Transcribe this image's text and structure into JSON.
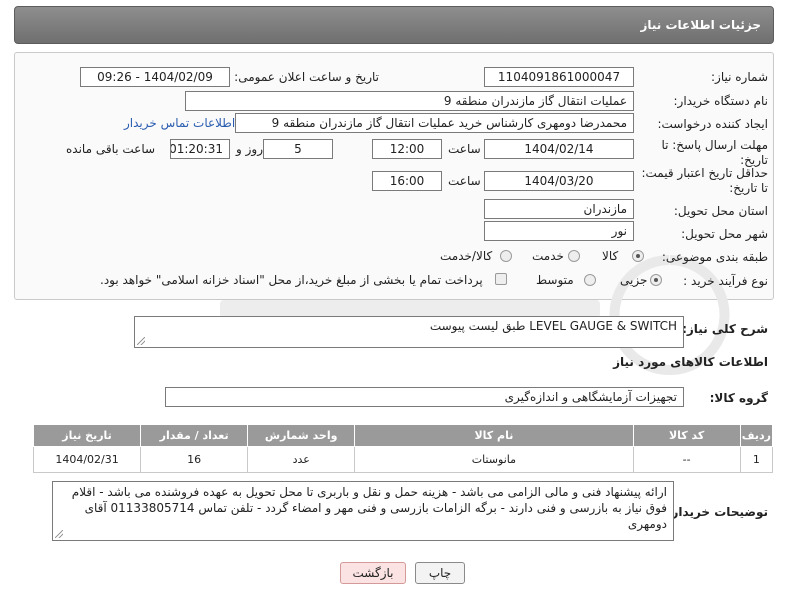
{
  "header": {
    "title": "جزئیات اطلاعات نیاز"
  },
  "form": {
    "need_number_label": "شماره نیاز:",
    "need_number": "1104091861000047",
    "announce_label": "تاریخ و ساعت اعلان عمومی:",
    "announce_value": "1404/02/09 - 09:26",
    "buyer_org_label": "نام دستگاه خریدار:",
    "buyer_org": "عملیات انتقال گاز مازندران منطقه 9",
    "creator_label": "ایجاد کننده درخواست:",
    "creator": "محمدرضا دومهری کارشناس خرید عملیات انتقال گاز مازندران منطقه 9",
    "contact_link": "اطلاعات تماس خریدار",
    "reply_deadline_label": "مهلت ارسال پاسخ: تا تاریخ:",
    "reply_date": "1404/02/14",
    "time_label": "ساعت",
    "reply_time": "12:00",
    "days_value": "5",
    "days_label": "روز و",
    "remaining_time": "01:20:31",
    "remaining_label": "ساعت باقی مانده",
    "price_validity_label": "حداقل تاریخ اعتبار قیمت: تا تاریخ:",
    "price_date": "1404/03/20",
    "price_time": "16:00",
    "province_label": "استان محل تحویل:",
    "province": "مازندران",
    "city_label": "شهر محل تحویل:",
    "city": "نور",
    "category_label": "طبقه بندی موضوعی:",
    "category_options": [
      "کالا",
      "خدمت",
      "کالا/خدمت"
    ],
    "process_label": "نوع فرآیند خرید :",
    "process_options": [
      "جزیی",
      "متوسط"
    ],
    "payment_note": "پرداخت تمام یا بخشی از مبلغ خرید،از محل \"اسناد خزانه اسلامی\" خواهد بود."
  },
  "description": {
    "label": "شرح کلی نیاز:",
    "value": "LEVEL GAUGE & SWITCH طبق لیست پیوست"
  },
  "goods_info": {
    "title": "اطلاعات کالاهای مورد نیاز",
    "group_label": "گروه کالا:",
    "group_value": "تجهیزات آزمایشگاهی و اندازه‌گیری"
  },
  "table": {
    "headers": [
      "ردیف",
      "کد کالا",
      "نام کالا",
      "واحد شمارش",
      "تعداد / مقدار",
      "تاریخ نیاز"
    ],
    "rows": [
      [
        "1",
        "--",
        "مانوستات",
        "عدد",
        "16",
        "1404/02/31"
      ]
    ]
  },
  "buyer_notes": {
    "label": "توضیحات خریدار:",
    "value": "ارائه پیشنهاد فنی و مالی الزامی می باشد - هزینه حمل و نقل و باربری تا محل تحویل به عهده فروشنده می باشد - اقلام فوق نیاز به بازرسی و فنی دارند - برگه الزامات بازرسی و فنی مهر و امضاء گردد - تلفن تماس 01133805714 آقای دومهری"
  },
  "buttons": {
    "print": "چاپ",
    "back": "بازگشت"
  },
  "colors": {
    "header_bg": "#7d7d7d",
    "table_header_bg": "#9a9a9a",
    "link": "#2a5db0",
    "back_button_bg": "#fbe3e3"
  }
}
